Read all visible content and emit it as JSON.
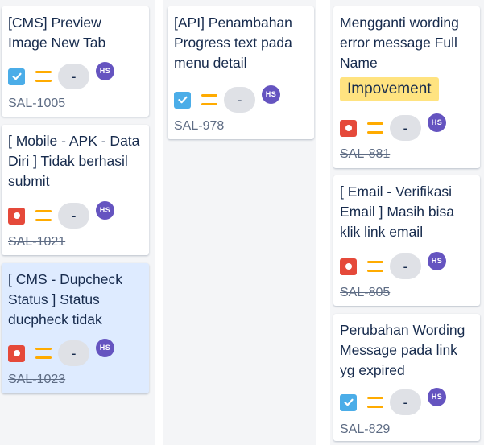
{
  "board": {
    "columns": [
      {
        "cards": [
          {
            "title": "[CMS] Preview Image New Tab",
            "type": "task",
            "estimate": "-",
            "assignee": "HS",
            "key": "SAL-1005",
            "done": false
          },
          {
            "title": "[ Mobile - APK - Data Diri ] Tidak berhasil submit",
            "type": "bug",
            "estimate": "-",
            "assignee": "HS",
            "key": "SAL-1021",
            "done": true
          },
          {
            "title": "[ CMS - Dupcheck Status ] Status ducpheck tidak",
            "type": "bug",
            "estimate": "-",
            "assignee": "HS",
            "key": "SAL-1023",
            "done": true,
            "selected": true
          }
        ]
      },
      {
        "cards": [
          {
            "title": "[API] Penambahan Progress text pada menu detail",
            "type": "task",
            "estimate": "-",
            "assignee": "HS",
            "key": "SAL-978",
            "done": false
          }
        ]
      },
      {
        "cards": [
          {
            "title": "Mengganti wording error message Full Name",
            "label": "Impovement",
            "type": "bug",
            "estimate": "-",
            "assignee": "HS",
            "key": "SAL-881",
            "done": true
          },
          {
            "title": "[ Email - Verifikasi Email ] Masih bisa klik link email",
            "type": "bug",
            "estimate": "-",
            "assignee": "HS",
            "key": "SAL-805",
            "done": true
          },
          {
            "title": "Perubahan Wording Message pada link yg expired",
            "type": "task",
            "estimate": "-",
            "assignee": "HS",
            "key": "SAL-829",
            "done": false
          }
        ]
      }
    ]
  },
  "icons": {
    "task": "checkbox-task-icon",
    "bug": "bug-icon",
    "priority": "priority-medium-icon"
  },
  "colors": {
    "task": "#4bade8",
    "bug": "#e5493a",
    "priority": "#ffab00",
    "avatar": "#6554c0",
    "label": "#ffe380",
    "column_bg": "#f4f5f7",
    "selected_card_bg": "#deebff"
  }
}
